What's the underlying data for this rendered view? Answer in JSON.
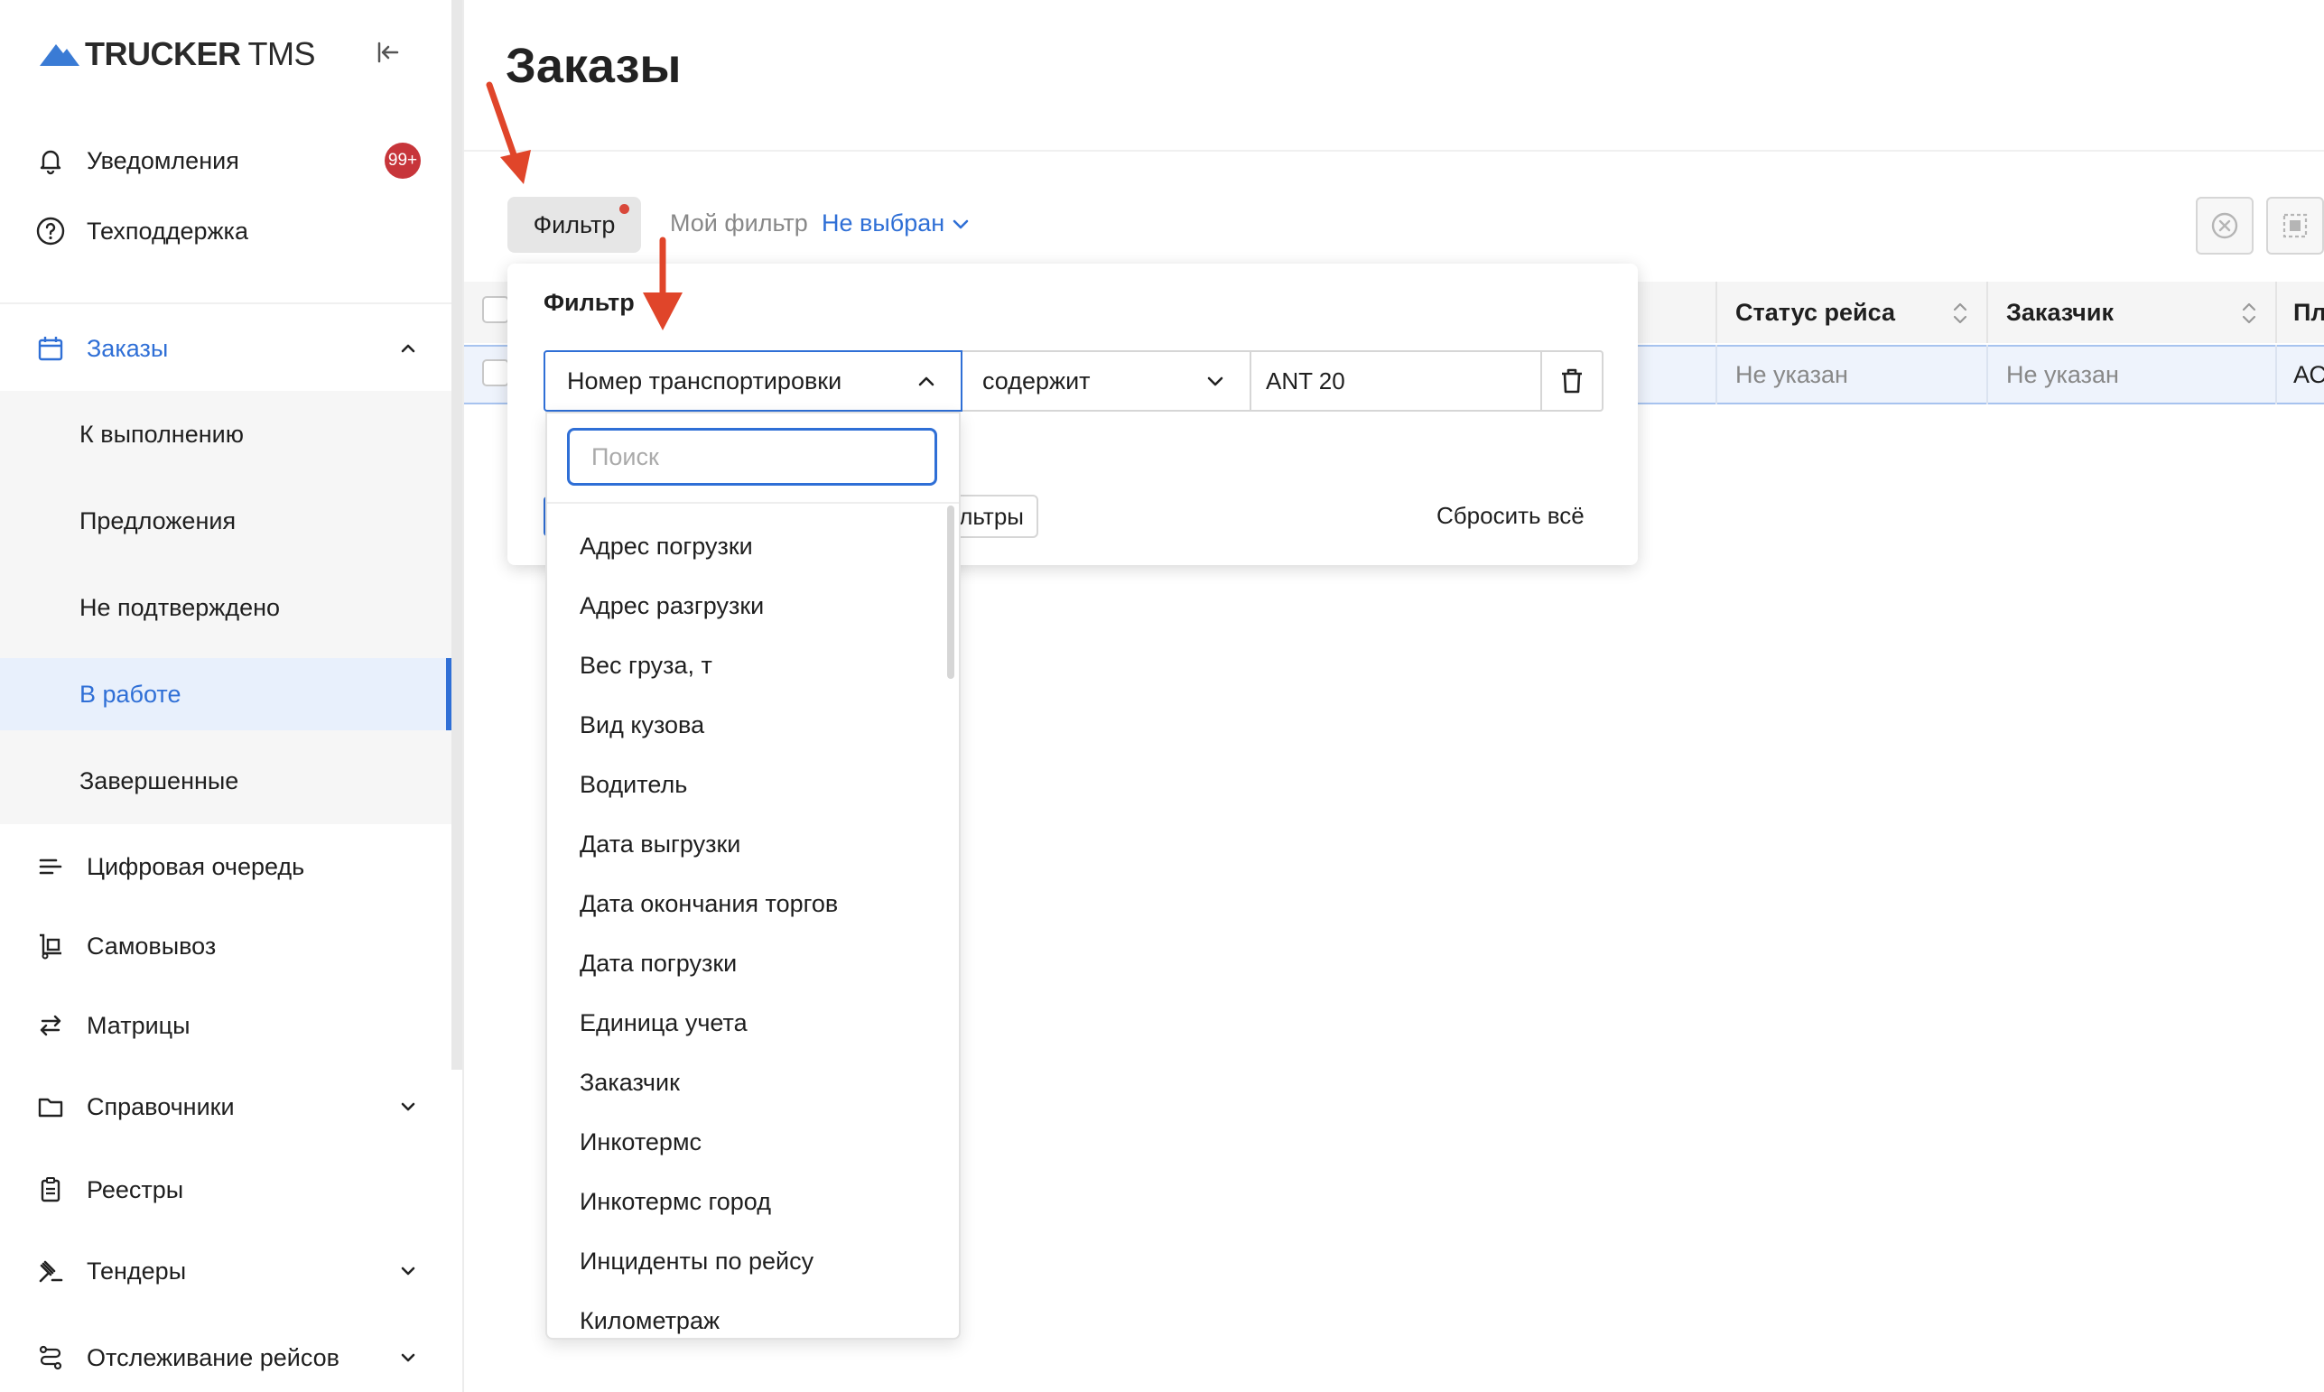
{
  "app": {
    "logo_bold": "TRUCKER",
    "logo_light": "TMS"
  },
  "sidebar": {
    "notifications": {
      "label": "Уведомления",
      "badge": "99+"
    },
    "support": {
      "label": "Техподдержка"
    },
    "orders": {
      "label": "Заказы",
      "children": [
        {
          "label": "К выполнению"
        },
        {
          "label": "Предложения"
        },
        {
          "label": "Не подтверждено"
        },
        {
          "label": "В работе"
        },
        {
          "label": "Завершенные"
        }
      ]
    },
    "items": [
      {
        "label": "Цифровая очередь"
      },
      {
        "label": "Самовывоз"
      },
      {
        "label": "Матрицы"
      },
      {
        "label": "Справочники"
      },
      {
        "label": "Реестры"
      },
      {
        "label": "Тендеры"
      },
      {
        "label": "Отслеживание рейсов"
      }
    ]
  },
  "main": {
    "title": "Заказы",
    "filter_button": "Фильтр",
    "my_filter_label": "Мой фильтр",
    "my_filter_value": "Не выбран"
  },
  "table": {
    "columns": [
      "Статус рейса",
      "Заказчик",
      "Пл"
    ],
    "row": [
      "Не указан",
      "Не указан",
      "АС"
    ]
  },
  "filter_panel": {
    "title": "Фильтр",
    "field": "Номер транспортировки",
    "operator": "содержит",
    "value": "ANT 20",
    "clear_partial": "льтры",
    "reset_all": "Сбросить всё"
  },
  "dropdown": {
    "search_placeholder": "Поиск",
    "options": [
      "Адрес погрузки",
      "Адрес разгрузки",
      "Вес груза, т",
      "Вид кузова",
      "Водитель",
      "Дата выгрузки",
      "Дата окончания торгов",
      "Дата погрузки",
      "Единица учета",
      "Заказчик",
      "Инкотермс",
      "Инкотермс город",
      "Инциденты по рейсу",
      "Километраж"
    ]
  },
  "colors": {
    "accent": "#2f6fd6",
    "badge": "#c7353a",
    "arrow": "#e0452a"
  }
}
